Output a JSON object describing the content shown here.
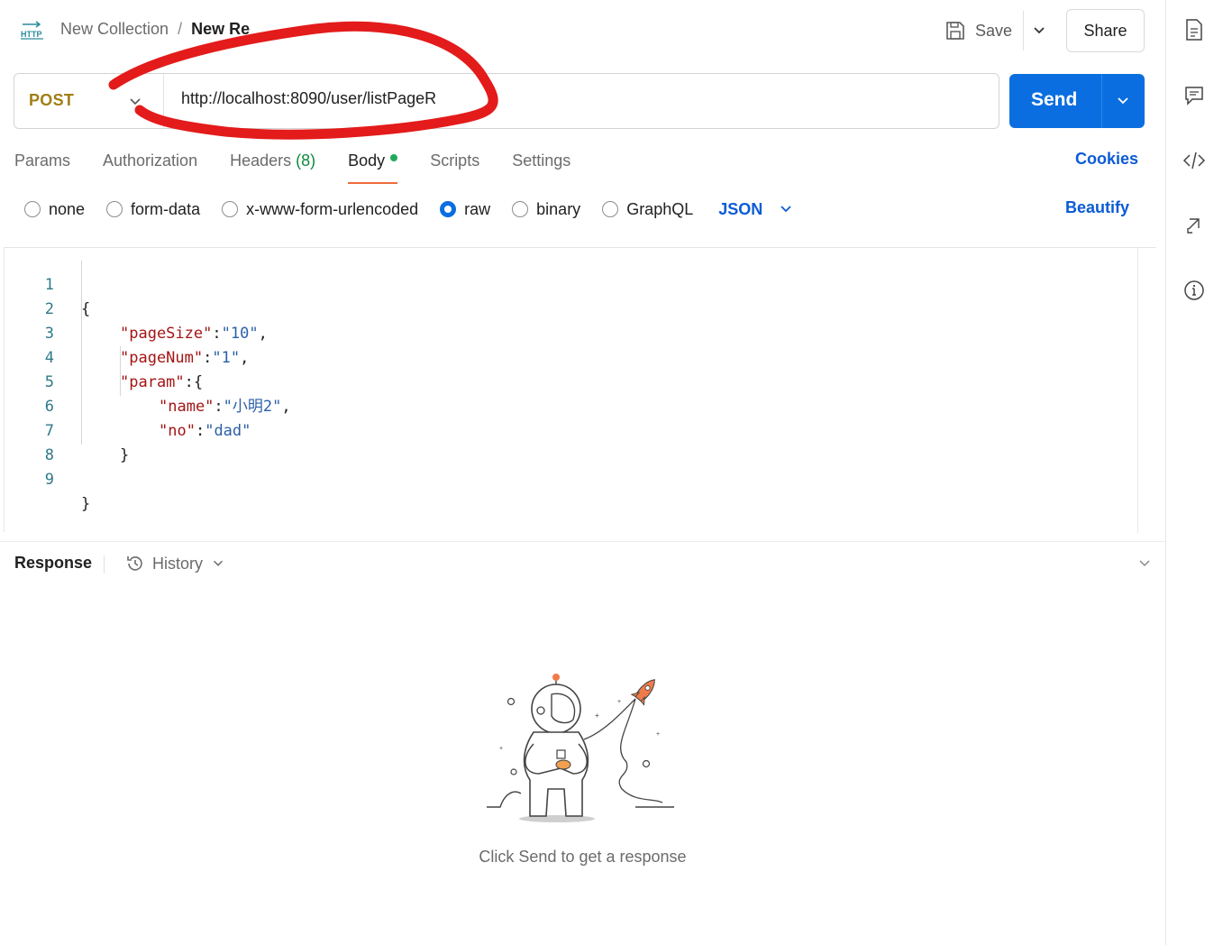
{
  "header": {
    "collection": "New Collection",
    "separator": "/",
    "request_name": "New Re",
    "save_label": "Save",
    "share_label": "Share"
  },
  "request": {
    "method": "POST",
    "url": "http://localhost:8090/user/listPageR",
    "send_label": "Send"
  },
  "tabs": [
    {
      "label": "Params"
    },
    {
      "label": "Authorization"
    },
    {
      "label": "Headers",
      "count": "(8)"
    },
    {
      "label": "Body",
      "active": true
    },
    {
      "label": "Scripts"
    },
    {
      "label": "Settings"
    }
  ],
  "cookies_label": "Cookies",
  "body_options": {
    "none": "none",
    "form_data": "form-data",
    "urlencoded": "x-www-form-urlencoded",
    "raw": "raw",
    "binary": "binary",
    "graphql": "GraphQL",
    "format": "JSON",
    "beautify": "Beautify"
  },
  "editor": {
    "line_numbers": [
      "1",
      "2",
      "3",
      "4",
      "5",
      "6",
      "7",
      "8",
      "9"
    ],
    "keys": {
      "pageSize": "\"pageSize\"",
      "pageNum": "\"pageNum\"",
      "param": "\"param\"",
      "name": "\"name\"",
      "no": "\"no\""
    },
    "values": {
      "pageSize": "\"10\"",
      "pageNum": "\"1\"",
      "name": "\"小明2\"",
      "no": "\"dad\""
    },
    "open_brace": "{",
    "close_brace": "}"
  },
  "response": {
    "label": "Response",
    "history_label": "History",
    "empty_message": "Click Send to get a response"
  },
  "colors": {
    "send_blue": "#0b6ee0",
    "method_post": "#a07f12",
    "link_blue": "#0b5bd6",
    "active_tab_underline": "#ee6b3d",
    "annotation_red": "#e31b1b"
  }
}
